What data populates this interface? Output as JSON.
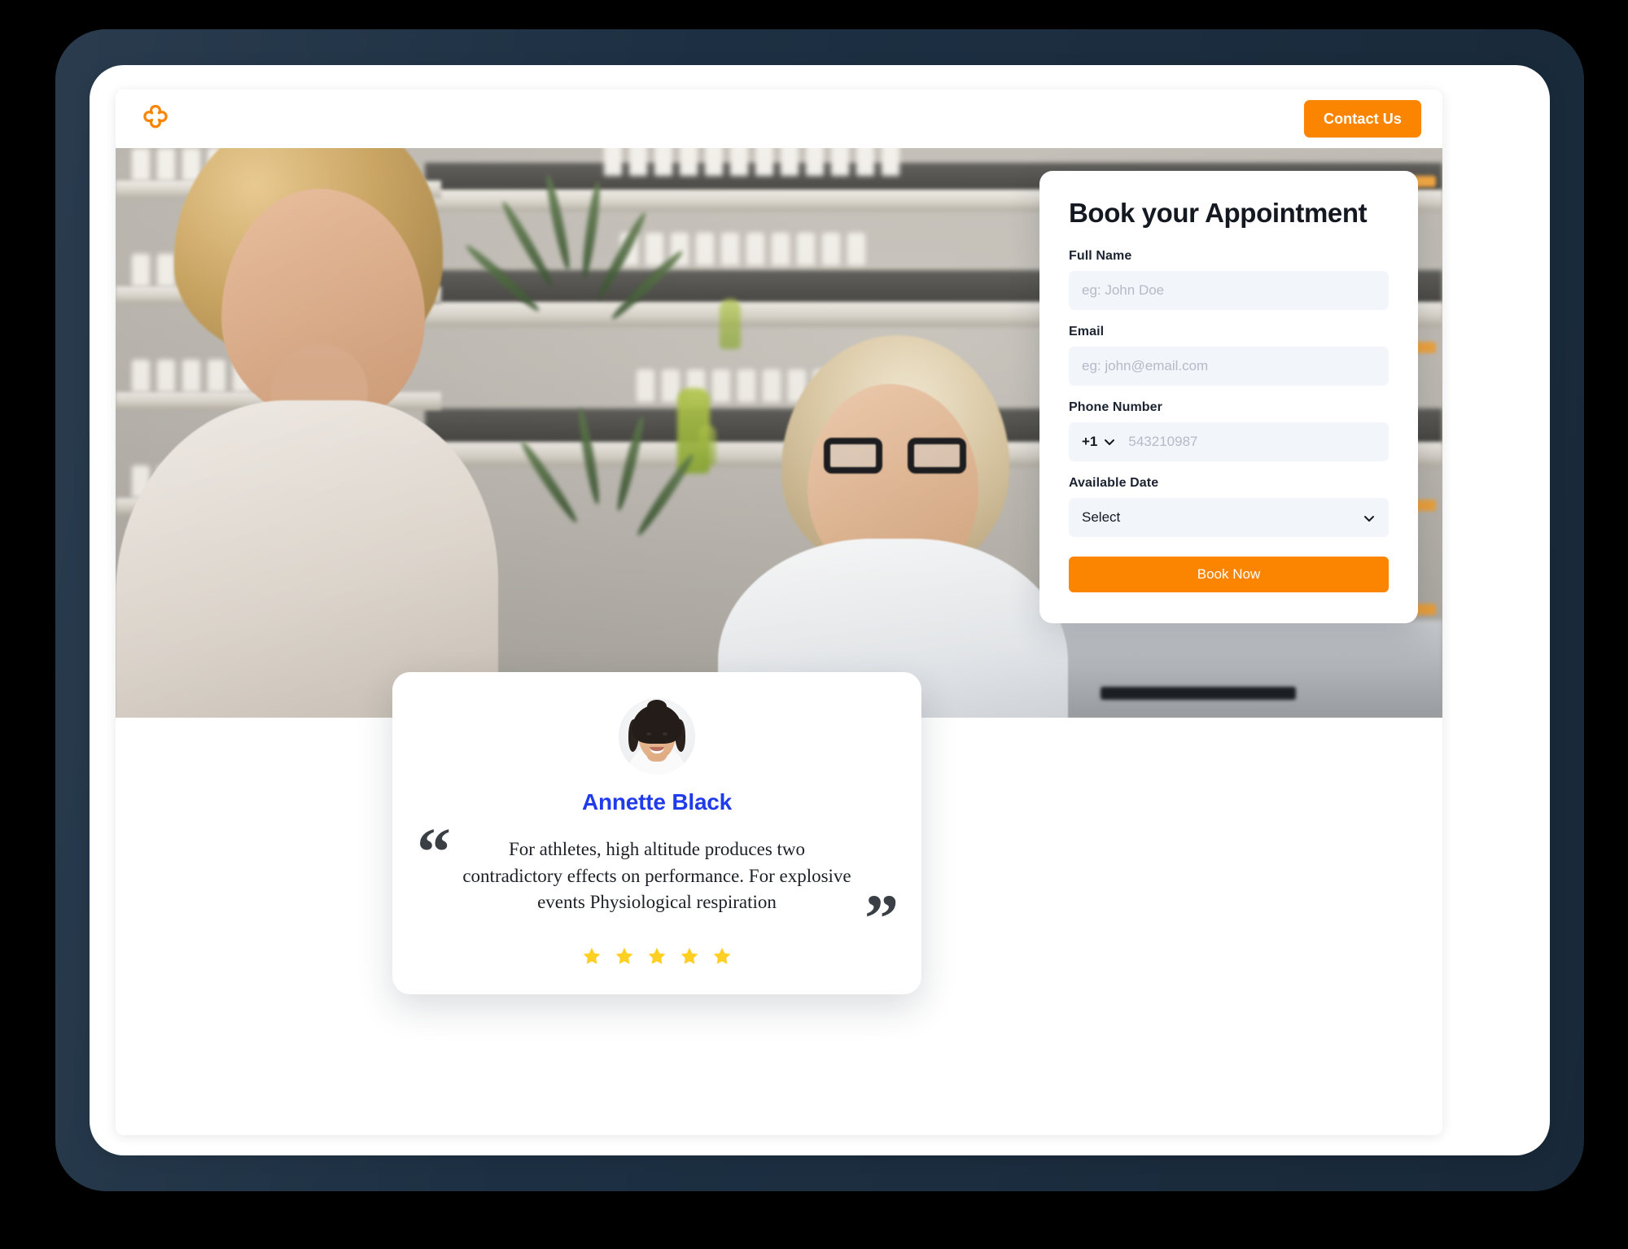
{
  "header": {
    "logo_icon": "medical-cross-logo-icon",
    "contact_label": "Contact Us"
  },
  "hero": {
    "image_alt": "Pharmacist in white coat speaking with a curly-haired customer in a pharmacy aisle"
  },
  "booking_form": {
    "title": "Book your Appointment",
    "fields": {
      "full_name": {
        "label": "Full Name",
        "placeholder": "eg: John Doe",
        "value": ""
      },
      "email": {
        "label": "Email",
        "placeholder": "eg: john@email.com",
        "value": ""
      },
      "phone": {
        "label": "Phone Number",
        "country_code": "+1",
        "placeholder": "543210987",
        "value": "",
        "dropdown_icon": "chevron-down-icon"
      },
      "available_date": {
        "label": "Available Date",
        "selected": "Select",
        "dropdown_icon": "chevron-down-icon"
      }
    },
    "submit_label": "Book Now"
  },
  "testimonial": {
    "avatar_icon": "reviewer-avatar",
    "name": "Annette Black",
    "quote_open": "“",
    "quote_close": "”",
    "quote": "For athletes, high altitude produces two contradictory effects on performance. For explosive events Physiological respiration",
    "rating": 5,
    "stars": [
      "star-1",
      "star-2",
      "star-3",
      "star-4",
      "star-5"
    ]
  },
  "colors": {
    "accent_orange": "#FB8500",
    "brand_blue": "#1F3BEB",
    "star_yellow": "#FFD023",
    "bezel_navy": "#1D3043",
    "input_bg": "#F2F5FA",
    "text_dark": "#141821"
  }
}
